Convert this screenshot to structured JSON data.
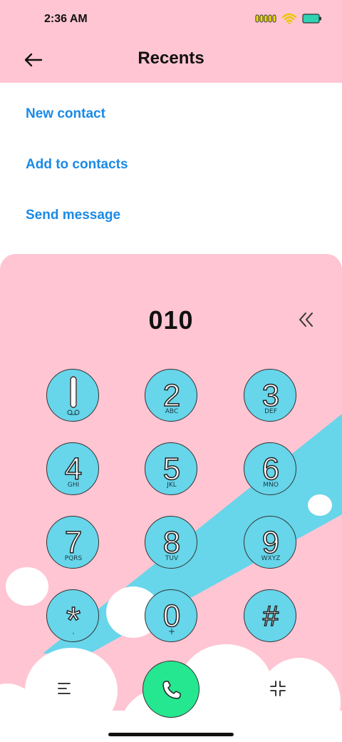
{
  "status_bar": {
    "time": "2:36 AM",
    "battery_color": "#2fd3b4"
  },
  "header": {
    "title": "Recents",
    "back_icon": "arrow-left-icon"
  },
  "actions": [
    {
      "label": "New contact"
    },
    {
      "label": "Add to contacts"
    },
    {
      "label": "Send message"
    }
  ],
  "dialer": {
    "number": "010",
    "keys": [
      {
        "digit": "1",
        "sub": "voicemail"
      },
      {
        "digit": "2",
        "sub": "ABC"
      },
      {
        "digit": "3",
        "sub": "DEF"
      },
      {
        "digit": "4",
        "sub": "GHI"
      },
      {
        "digit": "5",
        "sub": "JKL"
      },
      {
        "digit": "6",
        "sub": "MNO"
      },
      {
        "digit": "7",
        "sub": "PQRS"
      },
      {
        "digit": "8",
        "sub": "TUV"
      },
      {
        "digit": "9",
        "sub": "WXYZ"
      },
      {
        "digit": "*",
        "sub": ","
      },
      {
        "digit": "0",
        "sub": "+"
      },
      {
        "digit": "#",
        "sub": ""
      }
    ]
  },
  "colors": {
    "header_bg": "#ffc5d3",
    "link": "#1a8ae6",
    "key_fill": "#67d5ea",
    "call_button": "#25e790",
    "stripe": "#67d5ea"
  }
}
